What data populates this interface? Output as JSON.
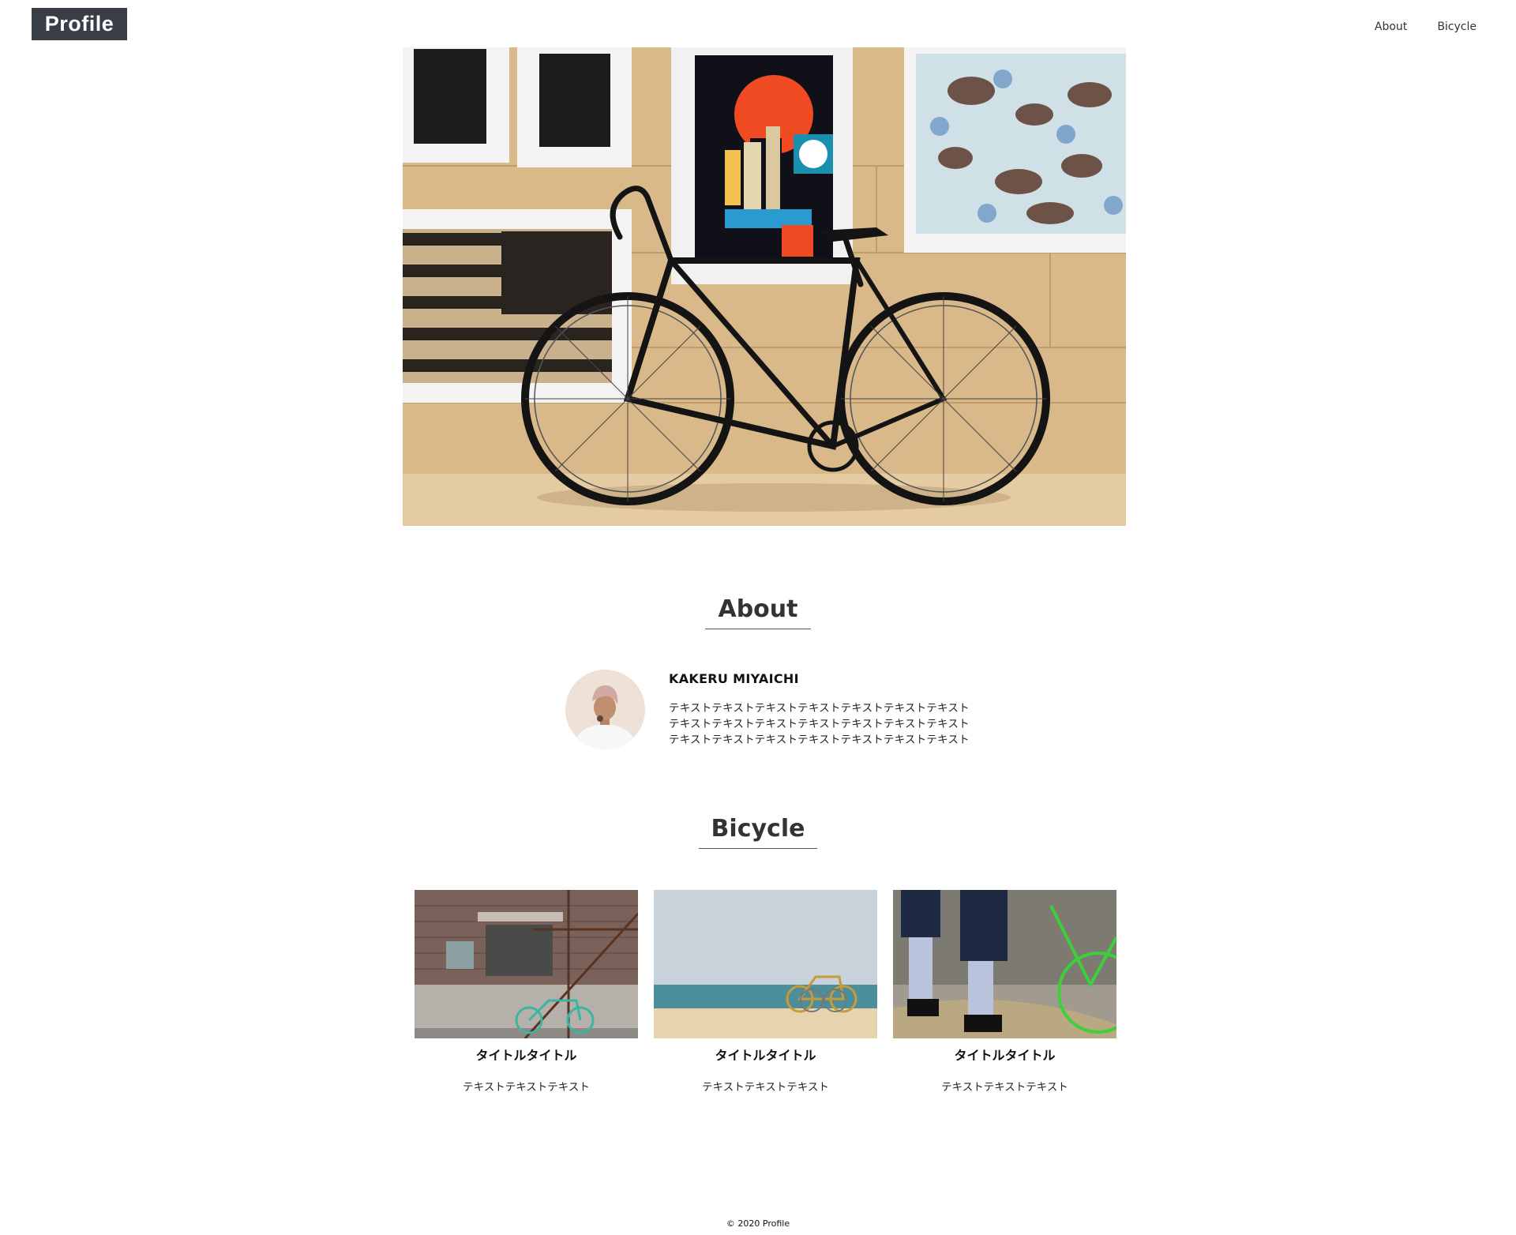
{
  "header": {
    "logo": "Profile",
    "nav": [
      "About",
      "Bicycle"
    ]
  },
  "hero": {
    "alt": "Road bicycle leaning against plywood wall with framed posters"
  },
  "about": {
    "title": "About",
    "name": "KAKERU MIYAICHI",
    "lines": [
      "テキストテキストテキストテキストテキストテキストテキスト",
      "テキストテキストテキストテキストテキストテキストテキスト",
      "テキストテキストテキストテキストテキストテキストテキスト"
    ]
  },
  "bicycle": {
    "title": "Bicycle",
    "cards": [
      {
        "title": "タイトルタイトル",
        "text": "テキストテキストテキスト"
      },
      {
        "title": "タイトルタイトル",
        "text": "テキストテキストテキスト"
      },
      {
        "title": "タイトルタイトル",
        "text": "テキストテキストテキスト"
      }
    ]
  },
  "footer": {
    "copyright": "© 2020 Profile"
  },
  "colors": {
    "logo_bg": "#383d46",
    "text": "#222222"
  }
}
